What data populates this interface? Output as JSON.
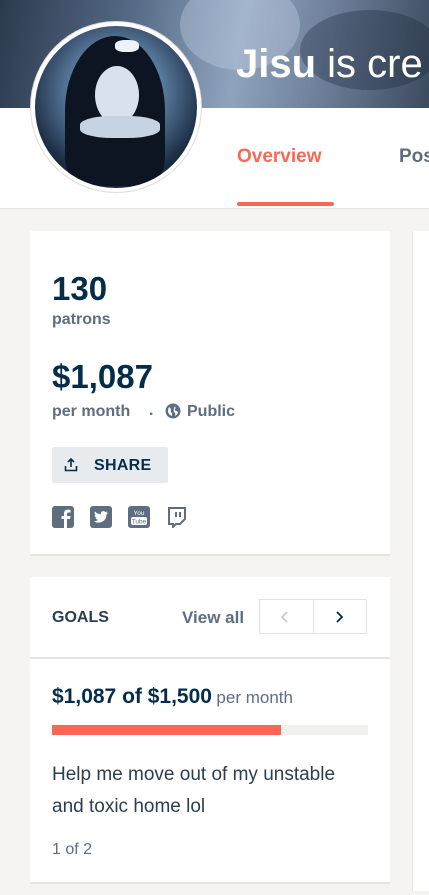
{
  "header": {
    "creator_name": "Jisu",
    "title_suffix": " is cre"
  },
  "tabs": [
    {
      "label": "Overview",
      "active": true
    },
    {
      "label": "Pos",
      "active": false
    }
  ],
  "stats": {
    "patrons_count": "130",
    "patrons_label": "patrons",
    "earnings_amount": "$1,087",
    "earnings_label": "per month",
    "separator": "·",
    "visibility_label": "Public"
  },
  "share": {
    "label": "SHARE"
  },
  "social_links": [
    "facebook-icon",
    "twitter-icon",
    "youtube-icon",
    "twitch-icon"
  ],
  "goals": {
    "heading": "GOALS",
    "view_all_label": "View all",
    "current": {
      "amount_text": "$1,087 of $1,500",
      "period": "per month",
      "progress_fraction": 0.725,
      "description": "Help me move out of my unstable and toxic home lol",
      "pagination": "1 of 2"
    }
  },
  "colors": {
    "accent": "#f96854",
    "navy": "#052d49",
    "gray_text": "#5f6d80"
  }
}
